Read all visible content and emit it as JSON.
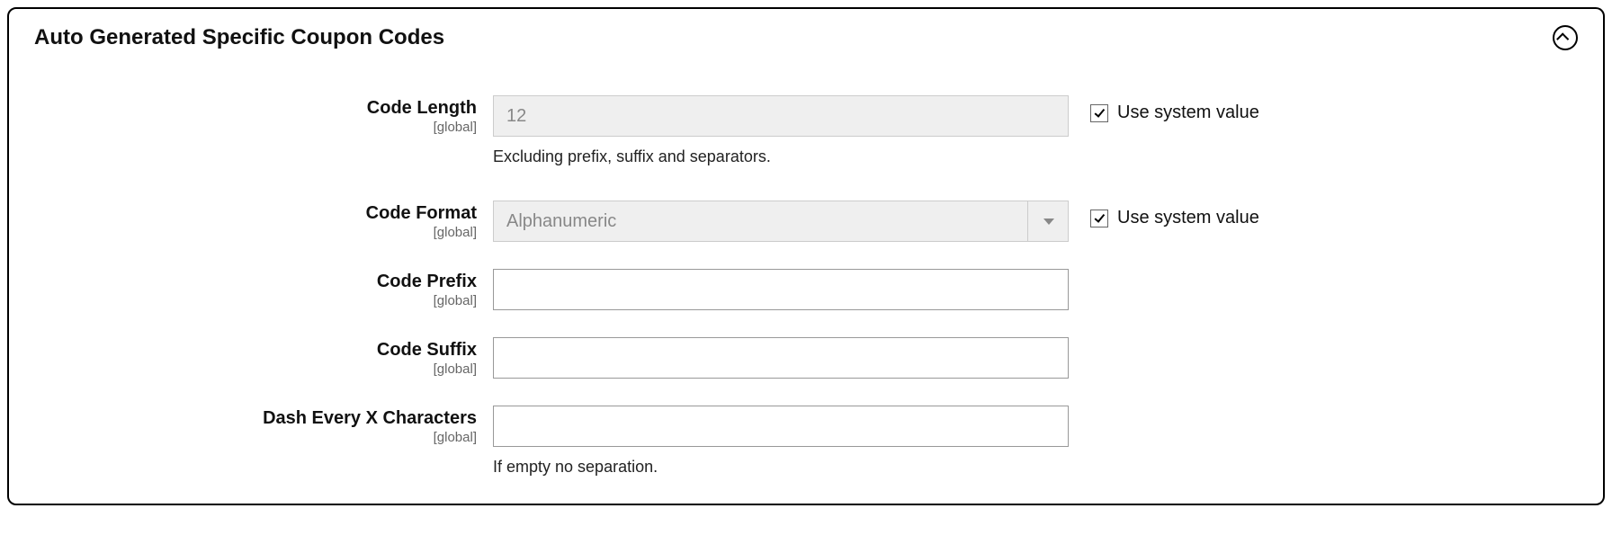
{
  "panel": {
    "title": "Auto Generated Specific Coupon Codes"
  },
  "fields": {
    "codeLength": {
      "label": "Code Length",
      "scope": "[global]",
      "value": "12",
      "helper": "Excluding prefix, suffix and separators.",
      "useSystemLabel": "Use system value"
    },
    "codeFormat": {
      "label": "Code Format",
      "scope": "[global]",
      "value": "Alphanumeric",
      "useSystemLabel": "Use system value"
    },
    "codePrefix": {
      "label": "Code Prefix",
      "scope": "[global]",
      "value": ""
    },
    "codeSuffix": {
      "label": "Code Suffix",
      "scope": "[global]",
      "value": ""
    },
    "dashEvery": {
      "label": "Dash Every X Characters",
      "scope": "[global]",
      "value": "",
      "helper": "If empty no separation."
    }
  }
}
